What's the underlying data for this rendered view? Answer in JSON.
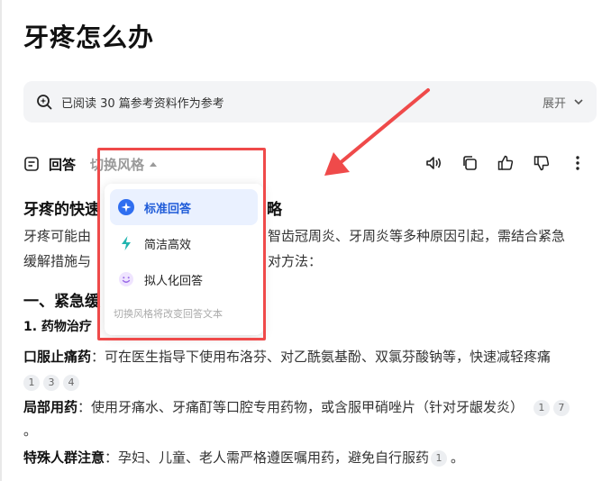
{
  "page": {
    "title": "牙疼怎么办"
  },
  "references": {
    "text": "已阅读 30 篇参考资料作为参考",
    "expand_label": "展开"
  },
  "toolbar": {
    "answer_label": "回答",
    "switch_style_label": "切换风格",
    "tools": [
      "speaker-icon",
      "copy-icon",
      "thumbs-up-icon",
      "thumbs-down-icon",
      "more-icon"
    ]
  },
  "dropdown": {
    "items": [
      {
        "label": "标准回答",
        "icon": "sparkle-icon",
        "active": true
      },
      {
        "label": "简洁高效",
        "icon": "lightning-icon",
        "active": false
      },
      {
        "label": "拟人化回答",
        "icon": "smile-icon",
        "active": false
      }
    ],
    "hint": "切换风格将改变回答文本"
  },
  "answer": {
    "heading_left": "牙疼的快速",
    "heading_right": "略",
    "intro_line1_left": "牙疼可能由",
    "intro_line1_right": "智齿冠周炎、牙周炎等多种原因引起，需结合紧急",
    "intro_line2_left": "缓解措施与",
    "intro_line2_right": "对方法：",
    "section1": "一、紧急缓",
    "subsection1": "1. 药物治疗",
    "items": [
      {
        "title": "口服止痛药",
        "text": "：可在医生指导下使用布洛芬、对乙酰氨基酚、双氯芬酸钠等，快速减轻疼痛",
        "cites": [
          "1",
          "3",
          "4"
        ]
      },
      {
        "title": "局部用药",
        "text": "：使用牙痛水、牙痛酊等口腔专用药物，或含服甲硝唑片（针对牙龈发炎）",
        "cites": [
          "1",
          "7"
        ],
        "trail": "。"
      },
      {
        "title": "特殊人群注意",
        "text": "：孕妇、儿童、老人需严格遵医嘱用药，避免自行服药",
        "cites": [
          "1"
        ],
        "trail": "。"
      }
    ]
  },
  "colors": {
    "highlight": "#ef4a4a",
    "accent": "#1e5bd8"
  }
}
